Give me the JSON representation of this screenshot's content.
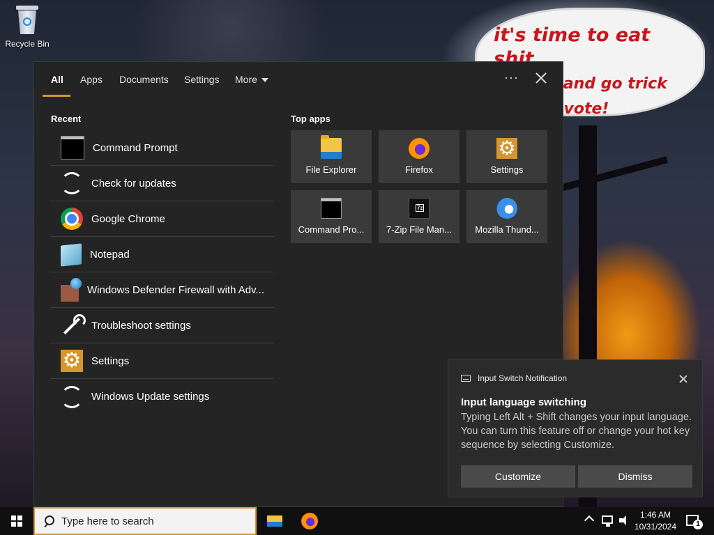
{
  "desktop": {
    "recycle_bin_label": "Recycle Bin",
    "wallpaper_text_line1": "it's time to eat shit",
    "wallpaper_text_line2": "and die and go trick",
    "wallpaper_text_line3": "ing and vote!"
  },
  "search_panel": {
    "tabs": [
      {
        "label": "All",
        "active": true
      },
      {
        "label": "Apps"
      },
      {
        "label": "Documents"
      },
      {
        "label": "Settings"
      },
      {
        "label": "More"
      }
    ],
    "more_options_label": "···",
    "recent_title": "Recent",
    "recent_items": [
      {
        "label": "Command Prompt",
        "icon": "command-prompt-icon"
      },
      {
        "label": "Check for updates",
        "icon": "sync-icon"
      },
      {
        "label": "Google Chrome",
        "icon": "chrome-icon"
      },
      {
        "label": "Notepad",
        "icon": "notepad-icon"
      },
      {
        "label": "Windows Defender Firewall with Adv...",
        "icon": "firewall-icon"
      },
      {
        "label": "Troubleshoot settings",
        "icon": "wrench-icon"
      },
      {
        "label": "Settings",
        "icon": "gear-icon"
      },
      {
        "label": "Windows Update settings",
        "icon": "sync-icon"
      }
    ],
    "top_apps_title": "Top apps",
    "top_apps": [
      {
        "label": "File Explorer",
        "icon": "folder-icon"
      },
      {
        "label": "Firefox",
        "icon": "firefox-icon"
      },
      {
        "label": "Settings",
        "icon": "gear-icon"
      },
      {
        "label": "Command Pro...",
        "icon": "command-prompt-icon"
      },
      {
        "label": "7-Zip File Man...",
        "icon": "7zip-icon"
      },
      {
        "label": "Mozilla Thund...",
        "icon": "thunderbird-icon"
      }
    ]
  },
  "notification": {
    "app_name": "Input Switch Notification",
    "title": "Input language switching",
    "body": "Typing Left Alt + Shift changes your input language. You can turn this feature off or change your hot key sequence by selecting Customize.",
    "customize_label": "Customize",
    "dismiss_label": "Dismiss"
  },
  "taskbar": {
    "search_placeholder": "Type here to search",
    "pinned_apps": [
      "File Explorer",
      "Firefox"
    ],
    "clock_time": "1:46 AM",
    "clock_date": "10/31/2024",
    "notification_count": "1"
  },
  "colors": {
    "accent": "#d5962e",
    "panel_bg": "#242424",
    "tile_bg": "#3a3a3a",
    "toast_bg": "#2b2b2b",
    "taskbar_bg": "#101010"
  }
}
